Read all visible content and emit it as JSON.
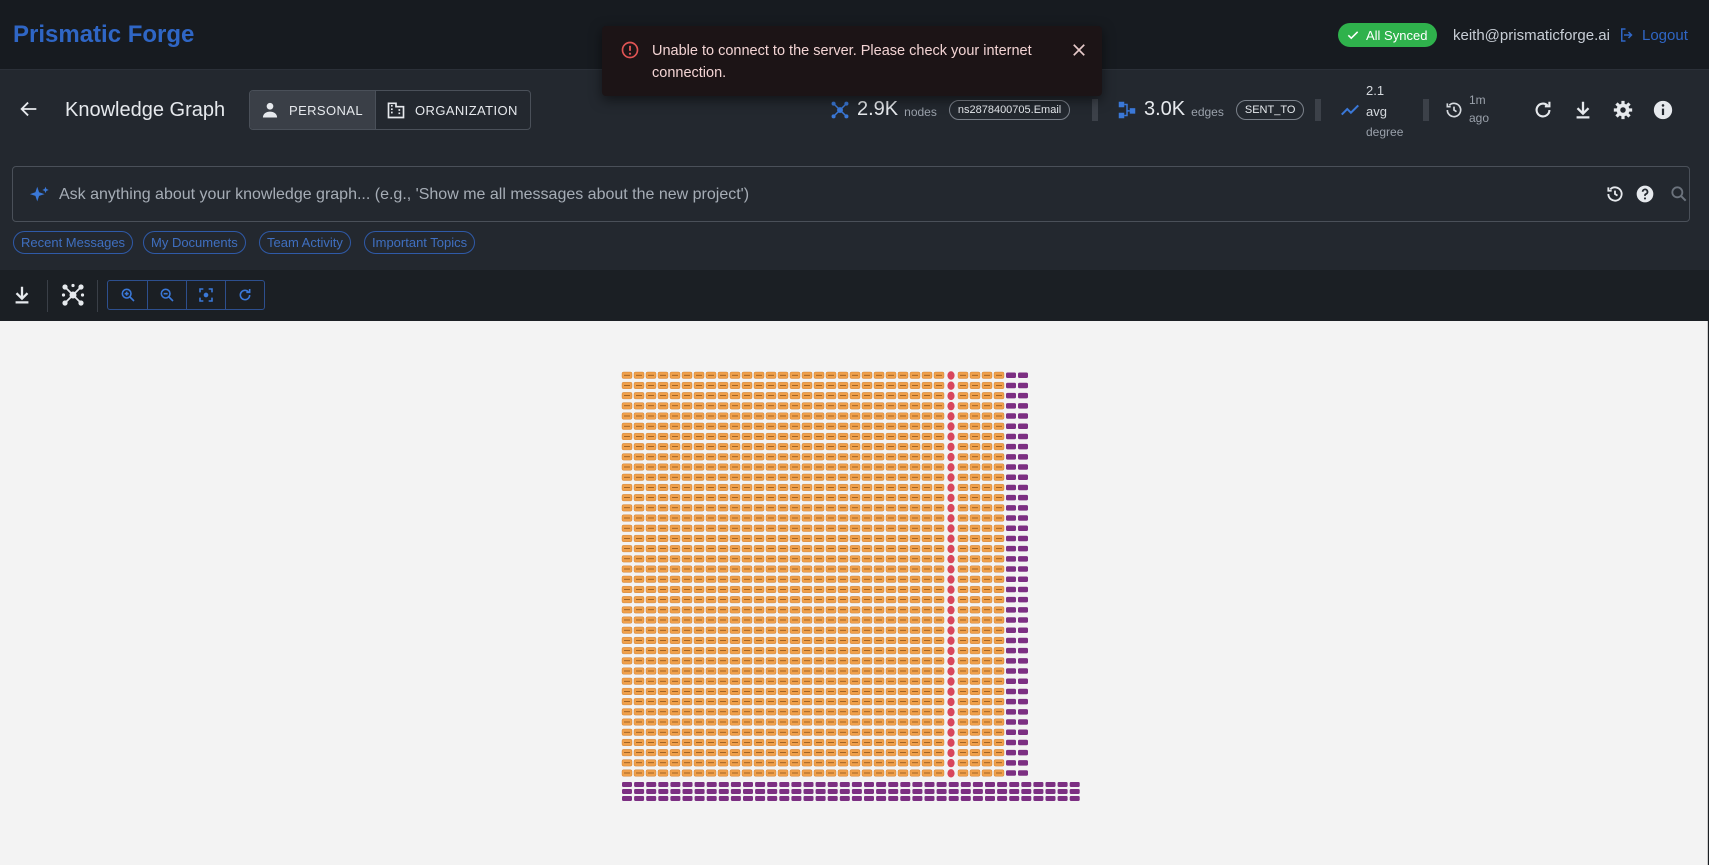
{
  "app": {
    "brand": "Prismatic Forge"
  },
  "topbar": {
    "sync_status": "All Synced",
    "user_email": "keith@prismaticforge.ai",
    "logout_label": "Logout"
  },
  "toast": {
    "message": "Unable to connect to the server. Please check your internet connection.",
    "severity": "error",
    "color": "#e05454"
  },
  "header": {
    "title": "Knowledge Graph",
    "scopes": [
      {
        "label": "PERSONAL",
        "icon": "person-icon",
        "active": true
      },
      {
        "label": "ORGANIZATION",
        "icon": "building-icon",
        "active": false
      }
    ],
    "stats": {
      "nodes_value": "2.9K",
      "nodes_label": "nodes",
      "nodes_type_chip": "ns2878400705.Email",
      "edges_value": "3.0K",
      "edges_label": "edges",
      "edges_type_chip": "SENT_TO",
      "degree_value": "2.1",
      "degree_label_1": "avg",
      "degree_label_2": "degree",
      "updated_value": "1m",
      "updated_label": "ago"
    },
    "actions": [
      "refresh-icon",
      "download-icon",
      "settings-icon",
      "info-icon"
    ]
  },
  "search": {
    "placeholder": "Ask anything about your knowledge graph... (e.g., 'Show me all messages about the new project')",
    "value": ""
  },
  "quick_queries": [
    "Recent Messages",
    "My Documents",
    "Team Activity",
    "Important Topics"
  ],
  "toolbar": {
    "icons": [
      "download-icon",
      "graph-layout-icon",
      "zoom-in-icon",
      "zoom-out-icon",
      "fit-to-screen-icon",
      "reset-icon"
    ]
  },
  "graph": {
    "colors": {
      "message_node": "#f0a04b",
      "person_node": "#d8465c",
      "topic_node": "#7c2f82",
      "background": "#f3f3f3"
    }
  },
  "colors": {
    "accent": "#2f66c5",
    "synced": "#2fb24c"
  }
}
